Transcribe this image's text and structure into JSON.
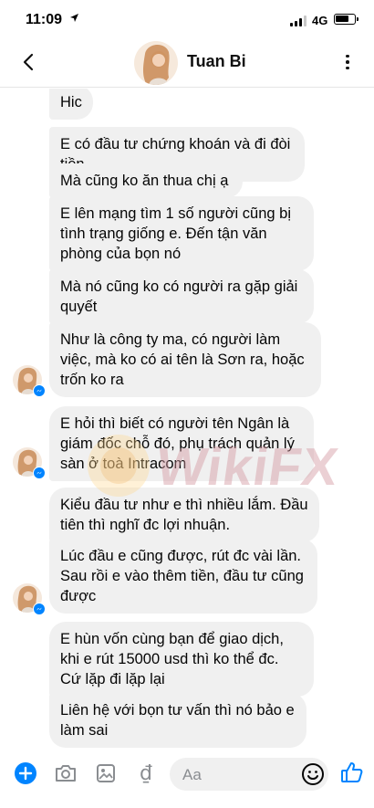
{
  "status_bar": {
    "time": "11:09",
    "network": "4G"
  },
  "header": {
    "contact_name": "Tuan Bi",
    "back_icon": "chevron-left-icon",
    "more_icon": "more-vertical-icon"
  },
  "messages": [
    "Hic",
    "E có đầu tư chứng khoán và đi đòi tiền",
    "Mà cũng ko ăn thua chị ạ",
    "E lên mạng tìm 1 số người cũng bị tình trạng giống e. Đến tận văn phòng của bọn nó",
    "Mà nó cũng ko có người ra gặp giải quyết",
    "Như là công ty ma, có người làm việc, mà ko có ai tên là Sơn ra, hoặc trốn ko ra",
    "E hỏi thì biết có người tên Ngân là giám đốc chỗ đó, phụ trách quản lý sàn ở toà Intracom",
    "Kiểu đầu tư như e thì nhiều lắm. Đầu tiên thì nghĩ đc lợi nhuận.",
    "Lúc đầu e cũng được, rút đc vài lần. Sau rồi e vào thêm tiền, đầu tư cũng được",
    "E hùn vốn cùng bạn để giao dịch, khi e rút 15000 usd thì ko thể đc. Cứ lặp đi lặp lại",
    "Liên hệ với bọn tư vấn thì nó bảo e làm sai"
  ],
  "watermark": {
    "text": "WikiFX"
  },
  "composer": {
    "placeholder": "Aa",
    "currency_glyph": "₫",
    "icons": [
      "plus-icon",
      "camera-icon",
      "image-icon",
      "dong-icon",
      "emoji-icon",
      "thumbs-up-icon"
    ]
  },
  "colors": {
    "accent": "#0084ff",
    "bubble": "#f0f0f0",
    "text": "#050505",
    "icon_gray": "#8a8d91"
  }
}
